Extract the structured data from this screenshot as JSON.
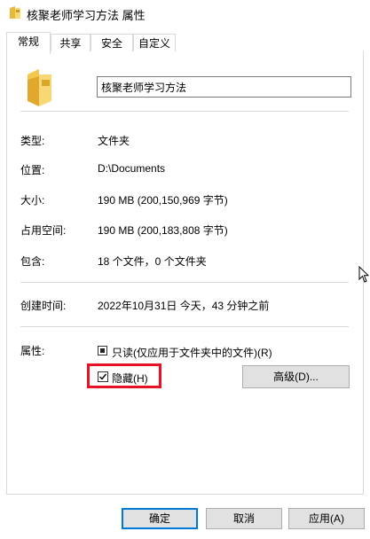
{
  "window": {
    "title": "核聚老师学习方法 属性"
  },
  "tabs": [
    {
      "label": "常规",
      "active": true
    },
    {
      "label": "共享",
      "active": false
    },
    {
      "label": "安全",
      "active": false
    },
    {
      "label": "自定义",
      "active": false
    }
  ],
  "general": {
    "folder_name": "核聚老师学习方法",
    "type": {
      "label": "类型:",
      "value": "文件夹"
    },
    "location": {
      "label": "位置:",
      "value": "D:\\Documents"
    },
    "size": {
      "label": "大小:",
      "value": "190 MB (200,150,969 字节)"
    },
    "size_on_disk": {
      "label": "占用空间:",
      "value": "190 MB (200,183,808 字节)"
    },
    "contains": {
      "label": "包含:",
      "value": "18 个文件，0 个文件夹"
    },
    "created": {
      "label": "创建时间:",
      "value": "2022年10月31日 今天，43 分钟之前"
    },
    "attributes": {
      "label": "属性:",
      "readonly": {
        "label": "只读(仅应用于文件夹中的文件)(R)",
        "state": "indeterminate"
      },
      "hidden": {
        "label": "隐藏(H)",
        "checked": true
      },
      "advanced_label": "高级(D)..."
    }
  },
  "footer": {
    "ok_label": "确定",
    "cancel_label": "取消",
    "apply_label": "应用(A)"
  },
  "colors": {
    "accent": "#0078d7",
    "highlight": "#e81123",
    "folder": "#f8d775"
  }
}
